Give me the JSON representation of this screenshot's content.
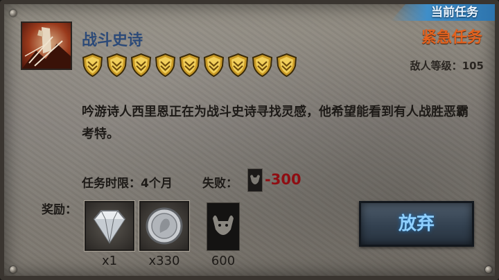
{
  "current_task_tab": "当前任务",
  "urgency": "紧急任务",
  "quest": {
    "title": "战斗史诗",
    "icon": "battle-epic-portrait-icon",
    "difficulty_shields": 9,
    "enemy_level_label": "敌人等级：",
    "enemy_level_value": "105",
    "description": "吟游诗人西里恩正在为战斗史诗寻找灵感，他希望能看到有人战胜恶霸考特。",
    "time_limit": "任务时限：4个月",
    "fail_label": "失败：",
    "fail_value": "-300",
    "fail_icon": "stress-bull-icon"
  },
  "rewards": {
    "label": "奖励：",
    "items": [
      {
        "icon": "diamond-icon",
        "count": "x1"
      },
      {
        "icon": "silver-coin-icon",
        "count": "x330"
      },
      {
        "icon": "stress-bull-icon",
        "count": "600"
      }
    ]
  },
  "abandon_button": "放弃",
  "colors": {
    "tab_blue": "#3f8ec9",
    "urgent_orange": "#e2621f",
    "title_blue": "#2c4a78",
    "fail_red": "#8f0d12",
    "button_text": "#8fd0ff"
  }
}
